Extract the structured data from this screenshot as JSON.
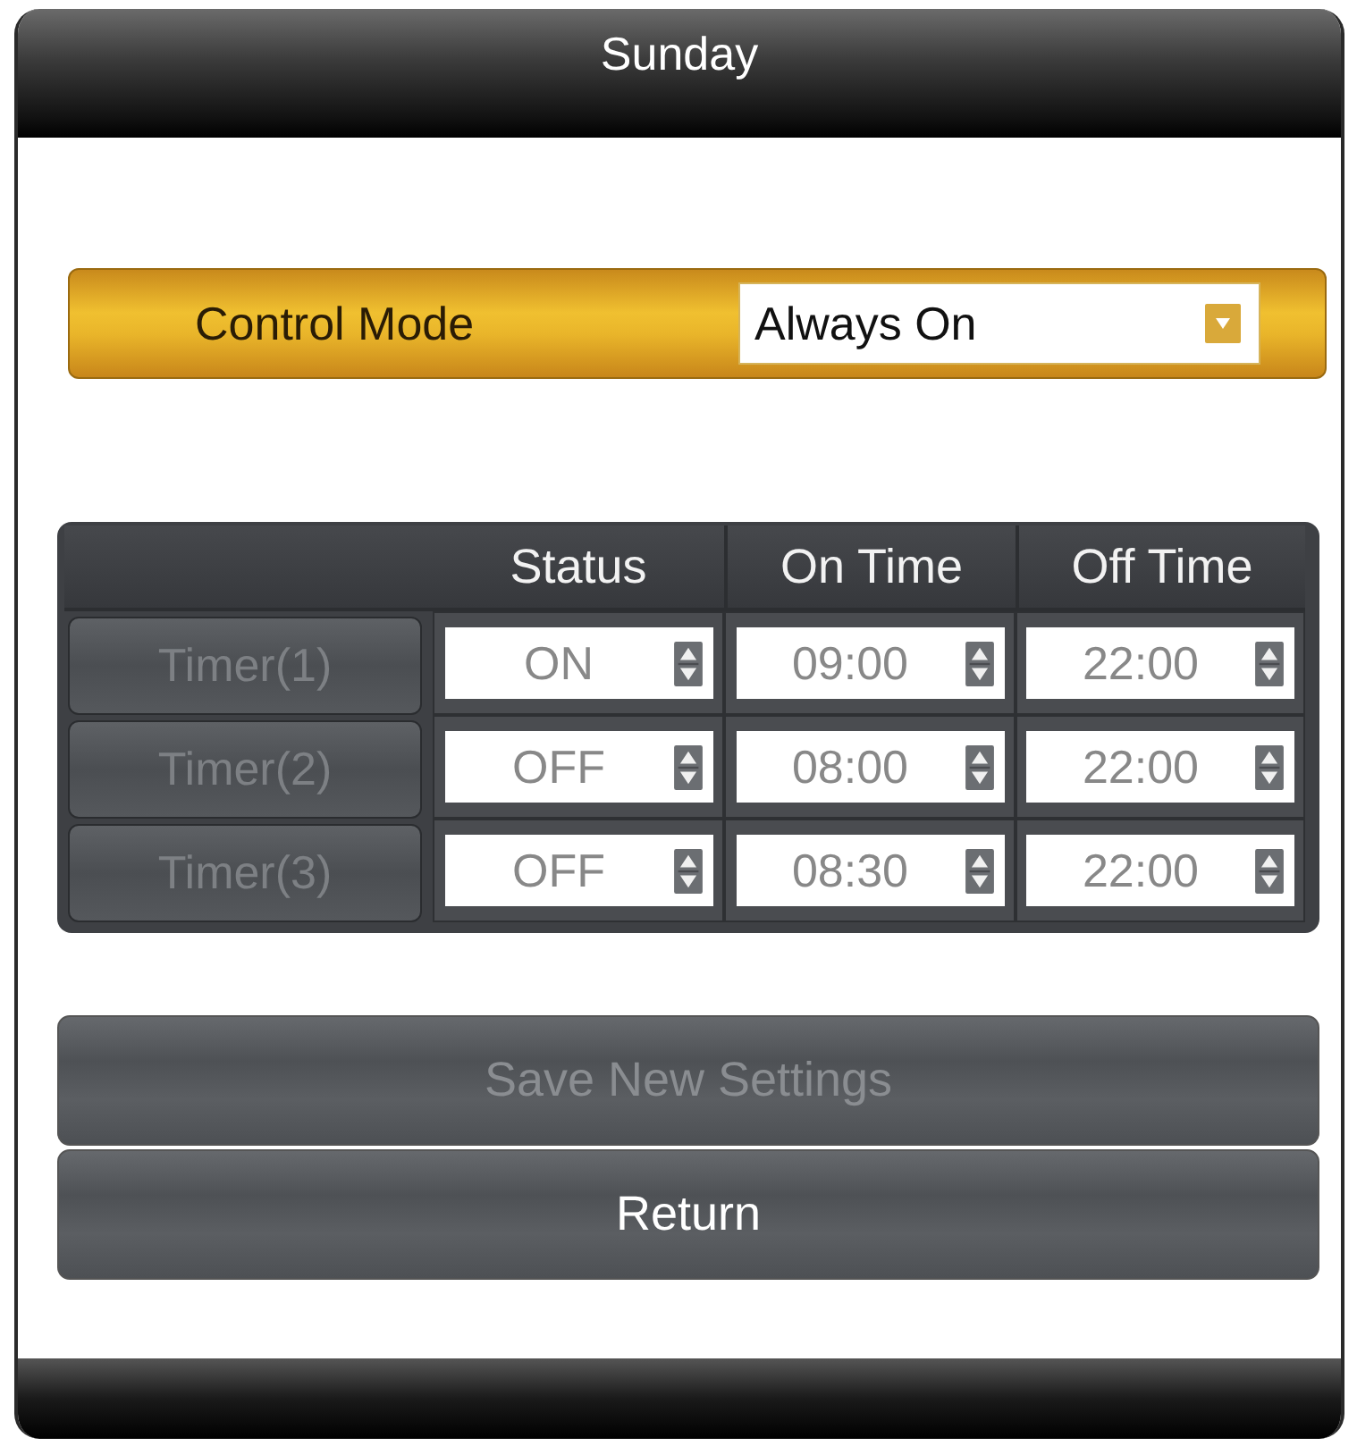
{
  "window": {
    "title": "Sunday"
  },
  "control_mode": {
    "label": "Control Mode",
    "value": "Always On"
  },
  "timer_table": {
    "columns": [
      "Status",
      "On Time",
      "Off Time"
    ],
    "rows": [
      {
        "label": "Timer(1)",
        "disabled": true,
        "status": "ON",
        "on_time": "09:00",
        "off_time": "22:00"
      },
      {
        "label": "Timer(2)",
        "disabled": true,
        "status": "OFF",
        "on_time": "08:00",
        "off_time": "22:00"
      },
      {
        "label": "Timer(3)",
        "disabled": true,
        "status": "OFF",
        "on_time": "08:30",
        "off_time": "22:00"
      }
    ]
  },
  "buttons": [
    {
      "label": "Save New Settings",
      "disabled": true
    },
    {
      "label": "Return",
      "disabled": false
    }
  ]
}
